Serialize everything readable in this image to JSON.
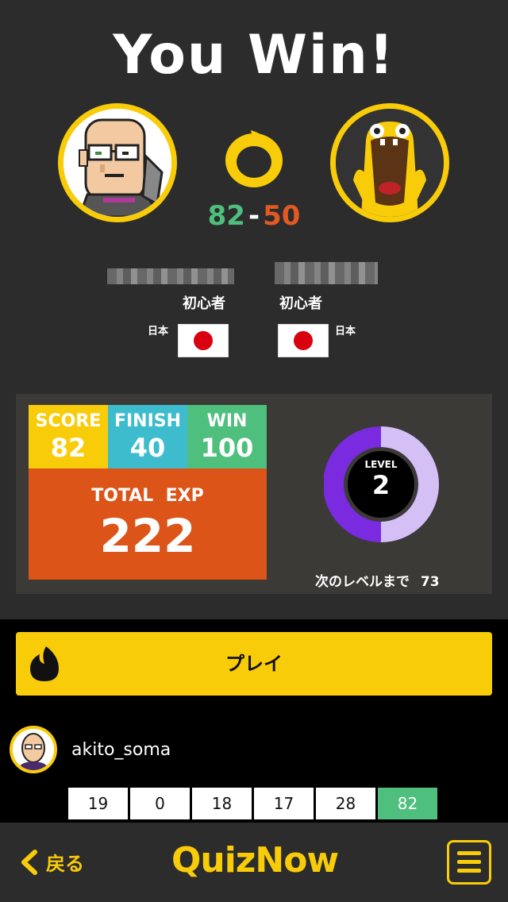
{
  "result": {
    "title": "You Win!"
  },
  "match": {
    "player_score": "82",
    "dash": "-",
    "opponent_score": "50"
  },
  "player": {
    "rank": "初心者",
    "country": "日本"
  },
  "opponent": {
    "rank": "初心者",
    "country": "日本"
  },
  "stats": {
    "score": {
      "label": "SCORE",
      "value": "82"
    },
    "finish": {
      "label": "FINISH",
      "value": "40"
    },
    "win": {
      "label": "WIN",
      "value": "100"
    },
    "total": {
      "label": "TOTAL  EXP",
      "value": "222"
    },
    "colors": {
      "score": "#f9cc0a",
      "finish": "#3dbccd",
      "win": "#4ebf7c",
      "total": "#dc5418"
    }
  },
  "level": {
    "label": "LEVEL",
    "value": "2",
    "next_label": "次のレベルまで",
    "next_value": "73",
    "progress_fraction": 0.5,
    "colors": {
      "ring": "#7a2be0",
      "track": "#d4c0f5"
    }
  },
  "play": {
    "label": "プレイ"
  },
  "profile": {
    "username": "akito_soma"
  },
  "history": [
    "19",
    "0",
    "18",
    "17",
    "28",
    "82"
  ],
  "footer": {
    "back_label": "戻る",
    "logo": "QuizNow"
  },
  "theme": {
    "accent": "#f9cc0a",
    "win_green": "#4ebf7c",
    "loss_red": "#e25a22"
  }
}
